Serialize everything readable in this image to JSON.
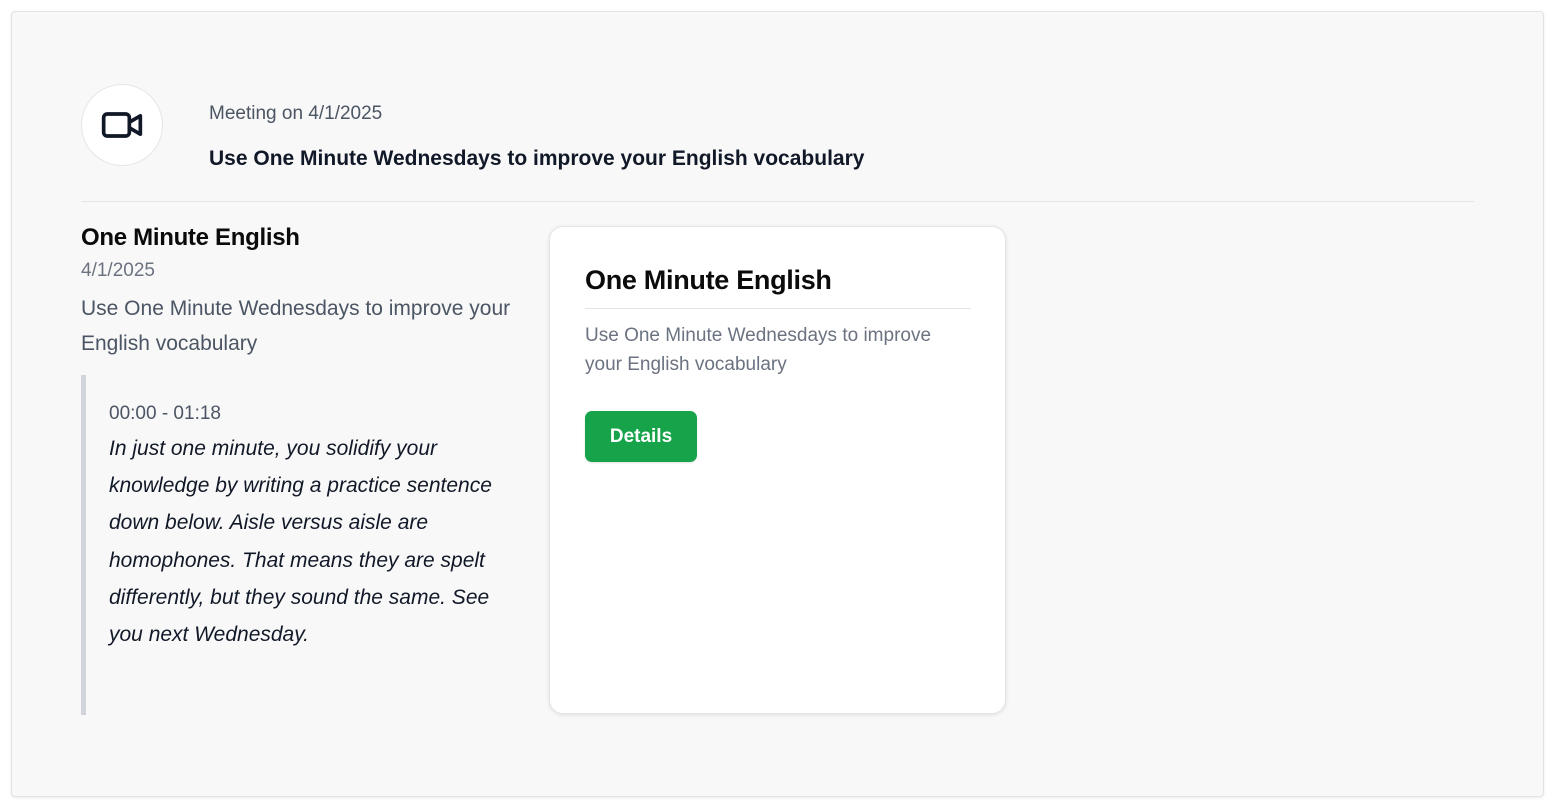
{
  "header": {
    "icon": "video-camera-icon",
    "meeting_date": "Meeting on 4/1/2025",
    "title": "Use One Minute Wednesdays to improve your English vocabulary"
  },
  "episode": {
    "title": "One Minute English",
    "date": "4/1/2025",
    "description": "Use One Minute Wednesdays to improve your English vocabulary",
    "segment": {
      "time_range": "00:00 - 01:18",
      "transcript": "In just one minute, you solidify your knowledge by writing a practice sentence down below. Aisle versus aisle are homophones. That means they are spelt differently, but they sound the same. See you next Wednesday."
    }
  },
  "card": {
    "title": "One Minute English",
    "description": "Use One Minute Wednesdays to improve your English vocabulary",
    "button_label": "Details",
    "button_color": "#16a34a"
  }
}
